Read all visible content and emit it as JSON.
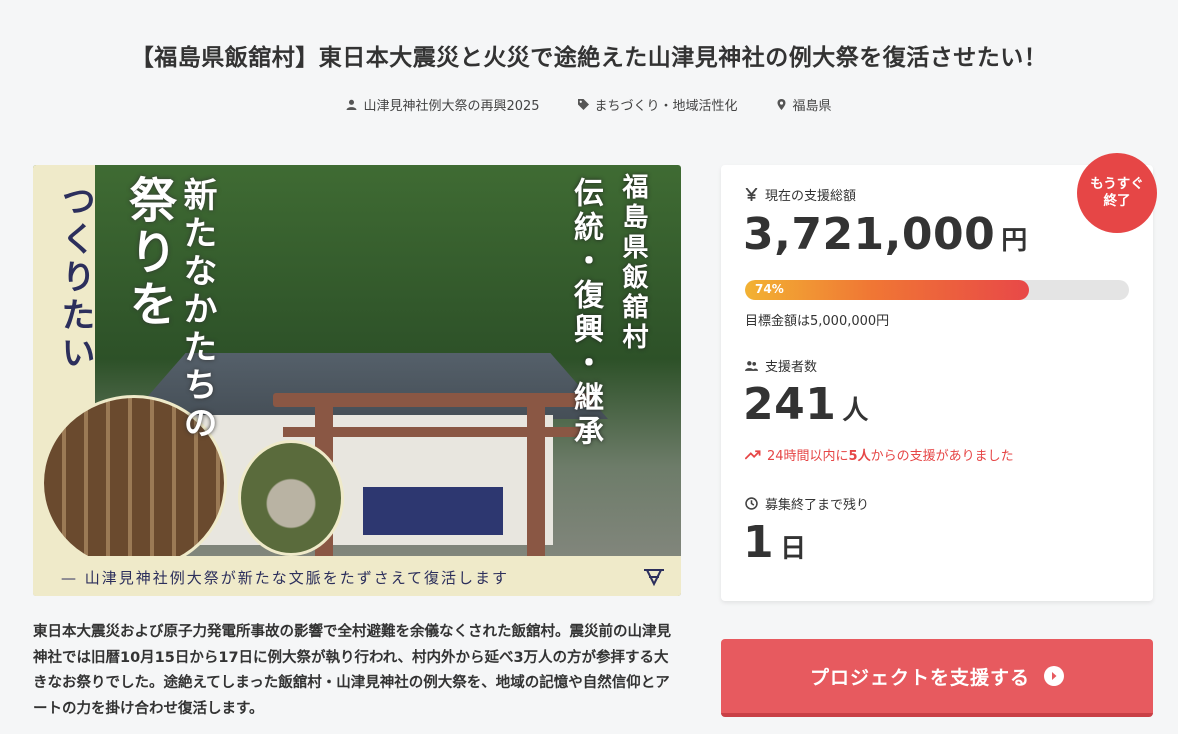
{
  "project": {
    "title": "【福島県飯舘村】東日本大震災と火災で途絶えた山津見神社の例大祭を復活させたい！",
    "owner": "山津見神社例大祭の再興2025",
    "category": "まちづくり・地域活性化",
    "location": "福島県"
  },
  "hero": {
    "vertical_text_1": "つくりたい",
    "vertical_text_2": "祭りを",
    "vertical_text_3": "新たなかたちの",
    "vertical_text_4": "伝統・復興・継承",
    "vertical_text_5": "福島県飯舘村",
    "caption": "— 山津見神社例大祭が新たな文脈をたずさえて復活します"
  },
  "description": "東日本大震災および原子力発電所事故の影響で全村避難を余儀なくされた飯舘村。震災前の山津見神社では旧暦10月15日から17日に例大祭が執り行われ、村内外から延べ3万人の方が参拝する大きなお祭りでした。途絶えてしまった飯舘村・山津見神社の例大祭を、地域の記憶や自然信仰とアートの力を掛け合わせ復活します。",
  "stats": {
    "badge_line1": "もうすぐ",
    "badge_line2": "終了",
    "total_label": "現在の支援総額",
    "total_value": "3,721,000",
    "total_unit": "円",
    "progress_pct": 74,
    "progress_label": "74%",
    "goal_text": "目標金額は5,000,000円",
    "supporters_label": "支援者数",
    "supporters_value": "241",
    "supporters_unit": "人",
    "recent_prefix": "24時間以内に",
    "recent_count": "5人",
    "recent_suffix": "からの支援がありました",
    "remaining_label": "募集終了まで残り",
    "remaining_value": "1",
    "remaining_unit": "日"
  },
  "cta": {
    "label": "プロジェクトを支援する"
  },
  "colors": {
    "accent": "#e64646",
    "cta": "#e75a5f",
    "progress_start": "#f2b233",
    "progress_end": "#e84848"
  },
  "icons": {
    "owner": "person-icon",
    "category": "tag-icon",
    "location": "pin-icon",
    "total": "yen-icon",
    "supporters": "people-icon",
    "recent": "trend-up-icon",
    "remaining": "clock-icon",
    "cta": "chevron-right-circle-icon"
  }
}
